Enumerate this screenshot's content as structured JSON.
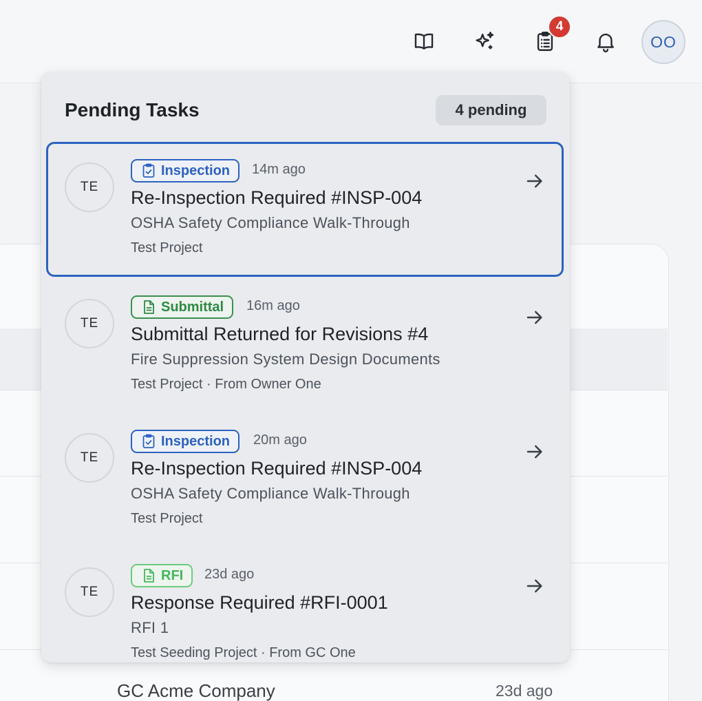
{
  "header": {
    "icons": [
      "book-icon",
      "sparkle-icon",
      "clipboard-icon",
      "bell-icon"
    ],
    "tasks_badge": "4",
    "avatar_initials": "OO"
  },
  "panel": {
    "title": "Pending Tasks",
    "pending_label": "4 pending",
    "tasks": [
      {
        "initials": "TE",
        "tag": "Inspection",
        "tag_type": "inspection",
        "ago": "14m ago",
        "title": "Re-Inspection Required #INSP-004",
        "subtitle": "OSHA Safety Compliance Walk-Through",
        "project": "Test Project"
      },
      {
        "initials": "TE",
        "tag": "Submittal",
        "tag_type": "submittal",
        "ago": "16m ago",
        "title": "Submittal Returned for Revisions #4",
        "subtitle": "Fire Suppression System Design Documents",
        "project": "Test Project · From Owner One"
      },
      {
        "initials": "TE",
        "tag": "Inspection",
        "tag_type": "inspection",
        "ago": "20m ago",
        "title": "Re-Inspection Required #INSP-004",
        "subtitle": "OSHA Safety Compliance Walk-Through",
        "project": "Test Project"
      },
      {
        "initials": "TE",
        "tag": "RFI",
        "tag_type": "rfi",
        "ago": "23d ago",
        "title": "Response Required #RFI-0001",
        "subtitle": "RFI 1",
        "project": "Test Seeding Project · From GC One"
      }
    ]
  },
  "background": {
    "row_company": "GC Acme Company",
    "row_time": "23d ago"
  },
  "colors": {
    "accent": "#2d62c0",
    "badge": "#d33a32",
    "submittal": "#2f8a44",
    "rfi": "#45b65c"
  }
}
